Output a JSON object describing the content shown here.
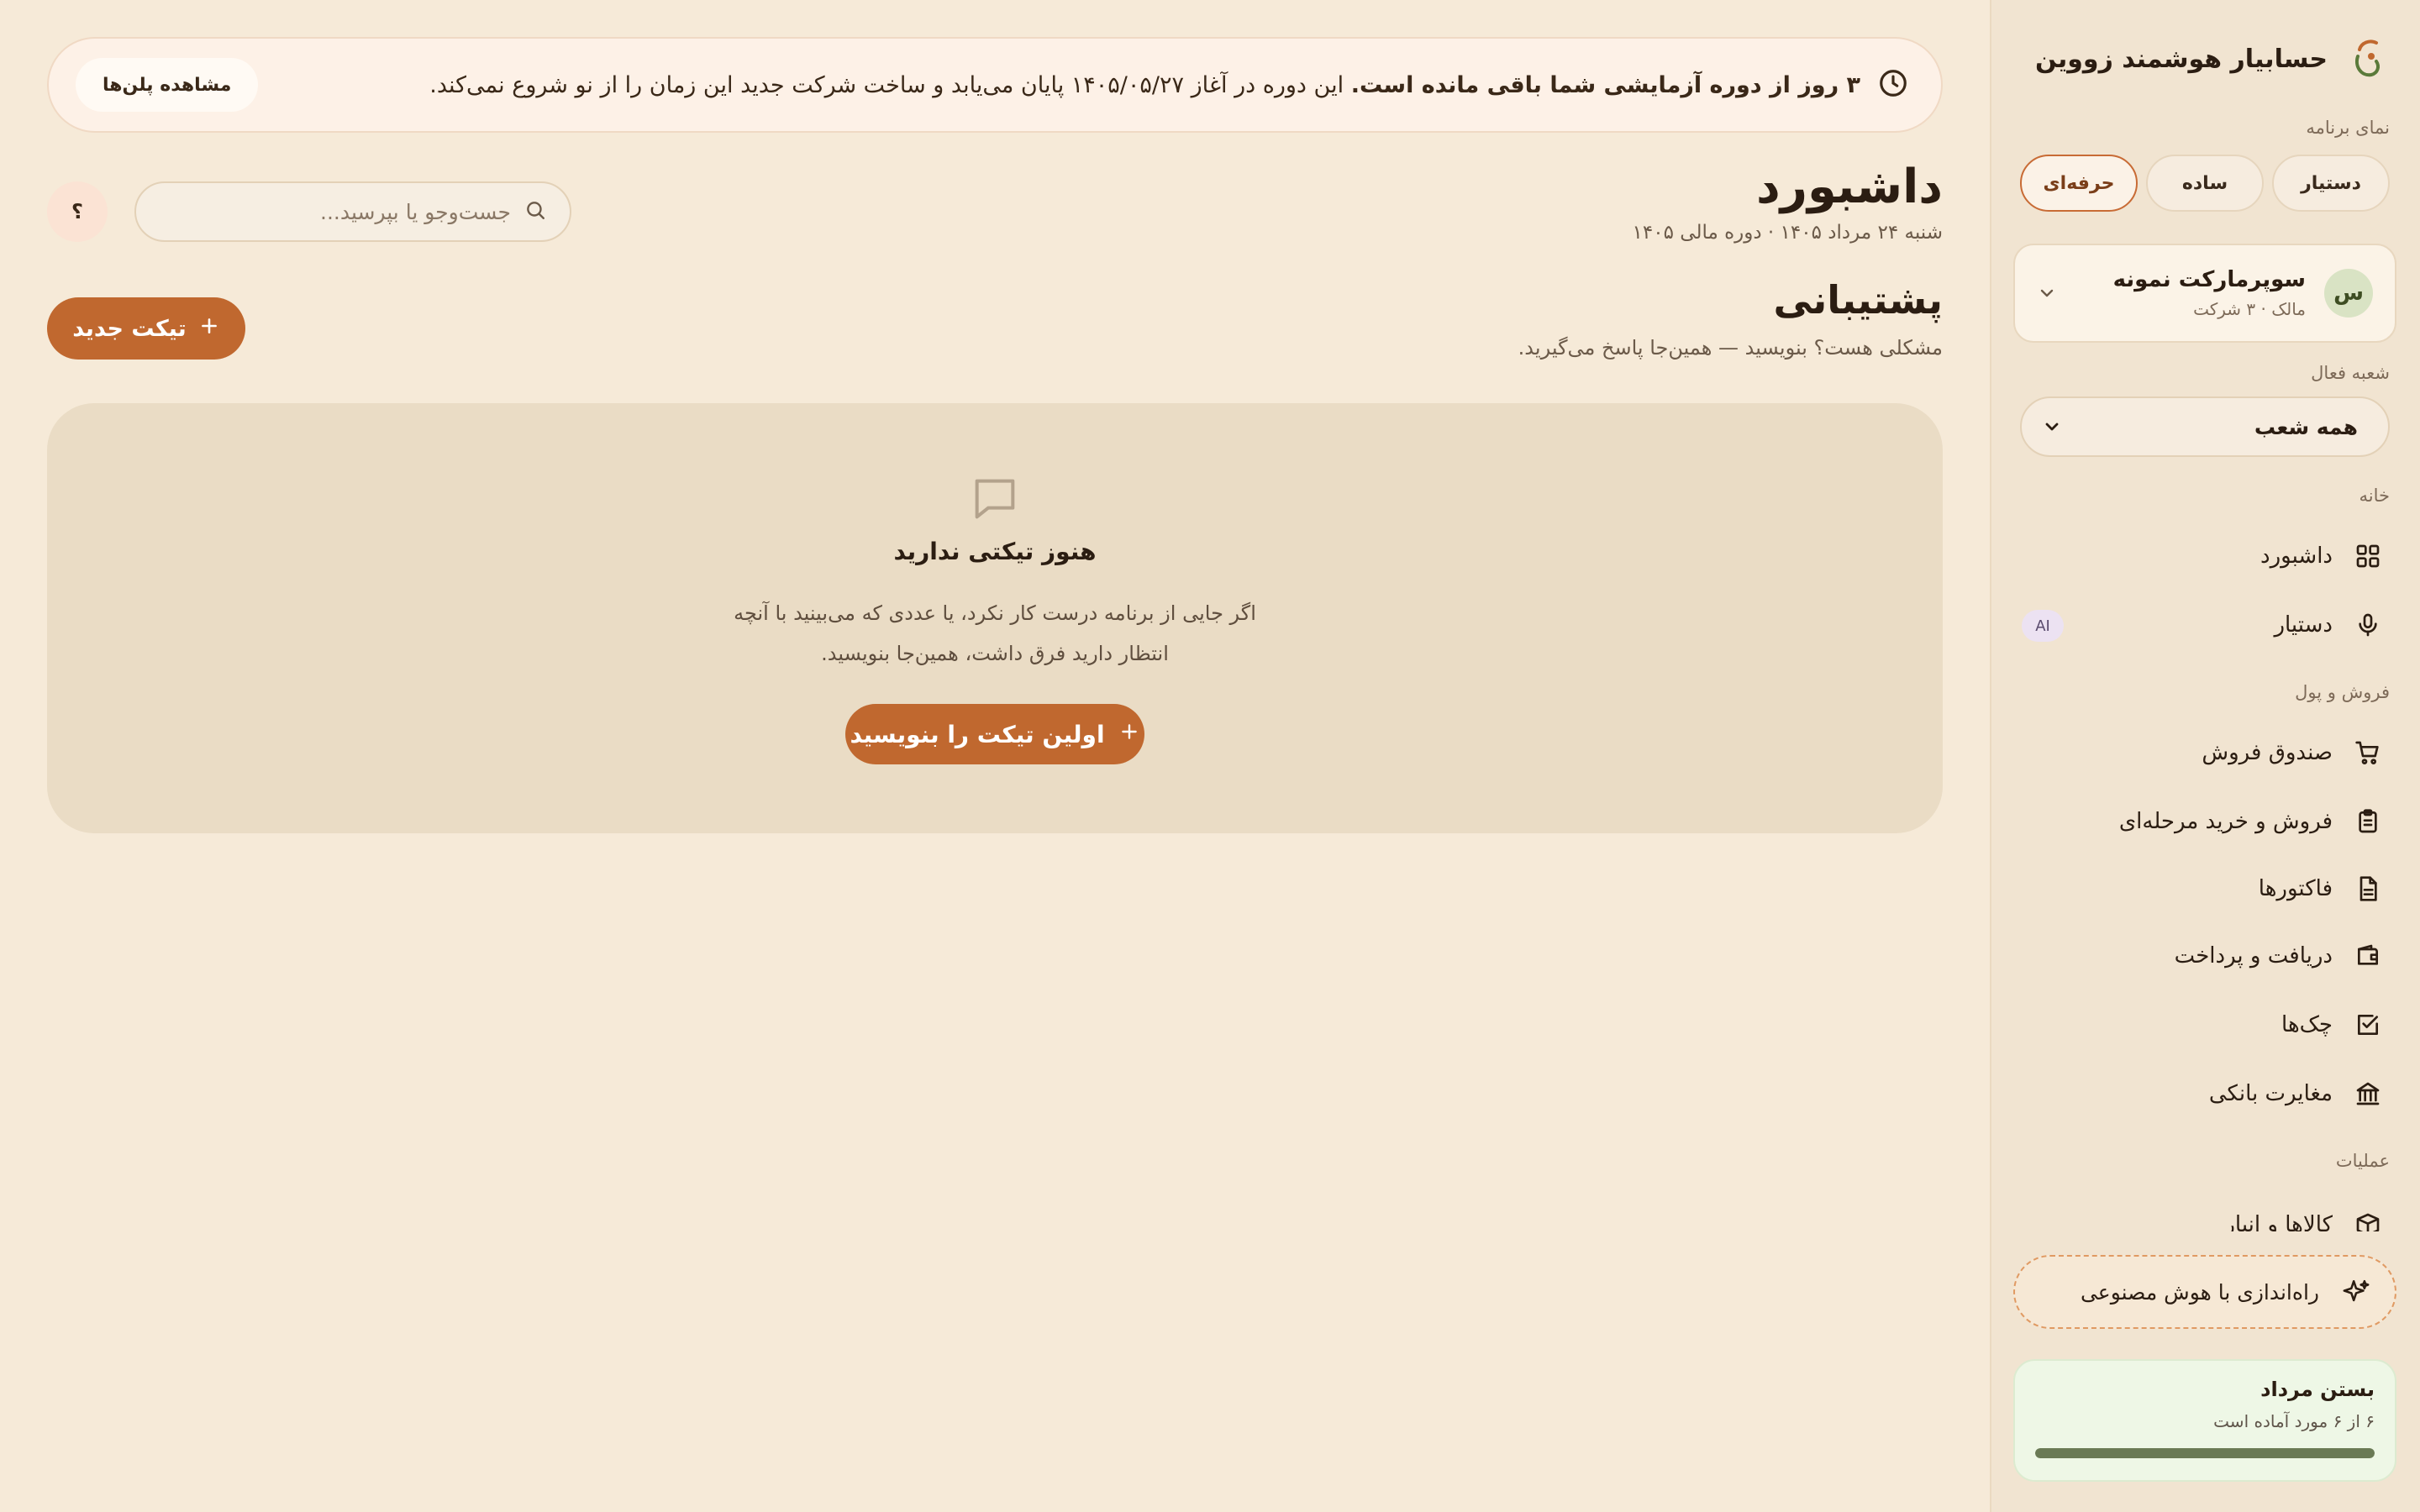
{
  "app": {
    "title": "حسابیار هوشمند زووین"
  },
  "sidebar": {
    "view_label": "نمای برنامه",
    "modes": [
      "دستیار",
      "ساده",
      "حرفه‌ای"
    ],
    "active_mode": "حرفه‌ای",
    "company": {
      "avatar_letter": "س",
      "name": "سوپرمارکت نمونه",
      "sub": "مالک · ۳ شرکت"
    },
    "branch_label": "شعبه فعال",
    "branch_value": "همه شعب",
    "sections": {
      "home": "خانه",
      "sales": "فروش و پول",
      "operations": "عملیات"
    },
    "nav": {
      "dashboard": "داشبورد",
      "assistant": "دستیار",
      "assistant_badge": "AI",
      "pos": "صندوق فروش",
      "staged": "فروش و خرید مرحله‌ای",
      "invoices": "فاکتورها",
      "payments": "دریافت و پرداخت",
      "checks": "چک‌ها",
      "bank": "مغایرت بانکی",
      "inventory": "کالاها و انبار"
    },
    "ai_setup": "راه‌اندازی با هوش مصنوعی",
    "close_month": {
      "title": "بستن مرداد",
      "sub": "۶ از ۶ مورد آماده است",
      "progress": 1.0
    }
  },
  "banner": {
    "bold_text": "۳ روز از دوره آزمایشی شما باقی مانده است.",
    "text": " این دوره در آغاز ۱۴۰۵/۰۵/۲۷ پایان می‌یابد و ساخت شرکت جدید این زمان را از نو شروع نمی‌کند.",
    "plans_button": "مشاهده پلن‌ها"
  },
  "header": {
    "title": "داشبورد",
    "subtitle": "شنبه ۲۴ مرداد ۱۴۰۵ · دوره مالی ۱۴۰۵",
    "search_placeholder": "جست‌وجو یا بپرسید...",
    "help_label": "؟"
  },
  "support": {
    "title": "پشتیبانی",
    "subtitle": "مشکلی هست؟ بنویسید — همین‌جا پاسخ می‌گیرید.",
    "new_ticket": "تیکت جدید",
    "empty_title": "هنوز تیکتی ندارید",
    "empty_desc_line1": "اگر جایی از برنامه درست کار نکرد، یا عددی که می‌بینید با آنچه",
    "empty_desc_line2": "انتظار دارید فرق داشت، همین‌جا بنویسید.",
    "first_ticket": "اولین تیکت را بنویسید"
  },
  "colors": {
    "accent": "#c0682f",
    "background": "#f6ead8",
    "sidebar": "#f1e4d1"
  }
}
